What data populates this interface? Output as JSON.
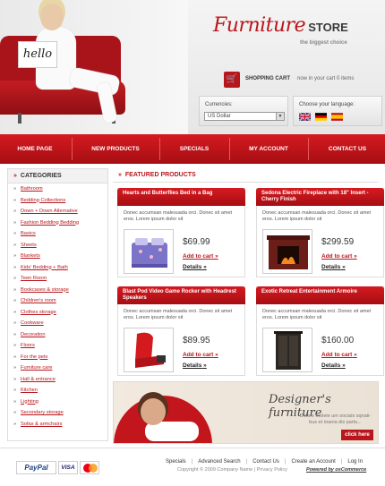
{
  "hero": {
    "sign_text": "hello"
  },
  "logo": {
    "script": "Furniture",
    "store": "STORE",
    "tagline": "the biggest choice"
  },
  "cart": {
    "label": "SHOPPING CART",
    "info": "now in your cart 0 items"
  },
  "currency": {
    "label": "Currencies:",
    "selected": "US Dollar"
  },
  "language": {
    "label": "Choose your language:",
    "flags": [
      "english-flag",
      "german-flag",
      "spanish-flag"
    ]
  },
  "nav": [
    "HOME PAGE",
    "NEW PRODUCTS",
    "SPECIALS",
    "MY ACCOUNT",
    "CONTACT US"
  ],
  "sidebar": {
    "title": "CATEGORIES",
    "items": [
      "Bathroom",
      "Bedding Collections",
      "Down + Down Alternative",
      "Fashion Bedding Bedding",
      "Basics",
      "Sheets",
      "Blankets",
      "Kids' Bedding + Bath",
      "Teen Room",
      "Bookcases & storage",
      "Children's room",
      "Clothes storage",
      "Cookware",
      "Decoration",
      "Floors",
      "For the pets",
      "Furniture care",
      "Hall & entrance",
      "Kitchen",
      "Lighting",
      "Secondary storage",
      "Sofas & armchairs"
    ]
  },
  "featured": {
    "title": "FEATURED PRODUCTS",
    "products": [
      {
        "name": "Hearts and Butterflies Bed in a Bag",
        "desc": "Donec accumsan malesuada orci. Donec sit amet eros. Lorem ipsum dolor sit",
        "price": "$69.99",
        "add": "Add to cart",
        "details": "Details"
      },
      {
        "name": "Sedona Electric Fireplace with 18\" Insert - Cherry Finish",
        "desc": "Donec accumsan malesuada orci. Donec sit amet eros. Lorem ipsum dolor sit",
        "price": "$299.59",
        "add": "Add to cart",
        "details": "Details"
      },
      {
        "name": "Blast Pod Video Game Rocker with Headrest Speakers",
        "desc": "Donec accumsan malesuada orci. Donec sit amet eros. Lorem ipsum dolor sit",
        "price": "$89.95",
        "add": "Add to cart",
        "details": "Details"
      },
      {
        "name": "Exotic Retreat Entertainment Armoire",
        "desc": "Donec accumsan malesuada orci. Donec sit amet eros. Lorem ipsum dolor sit",
        "price": "$160.00",
        "add": "Add to cart",
        "details": "Details"
      }
    ]
  },
  "banner": {
    "title": "Designer's furniture",
    "text": "Dolore moleie um sociais sqnati-bus et mania dis partu...",
    "button": "click here"
  },
  "footer": {
    "links": [
      "Specials",
      "Advanced Search",
      "Contact Us",
      "Create an Account",
      "Log In"
    ],
    "copyright": "Copyright © 2009 Company Name | Privacy Policy",
    "powered": "Powered by osCommerce",
    "payments": {
      "paypal": "PayPal",
      "visa": "VISA"
    }
  },
  "colors": {
    "accent": "#b8161c",
    "nav_top": "#d51a20",
    "nav_bottom": "#a50e13"
  }
}
